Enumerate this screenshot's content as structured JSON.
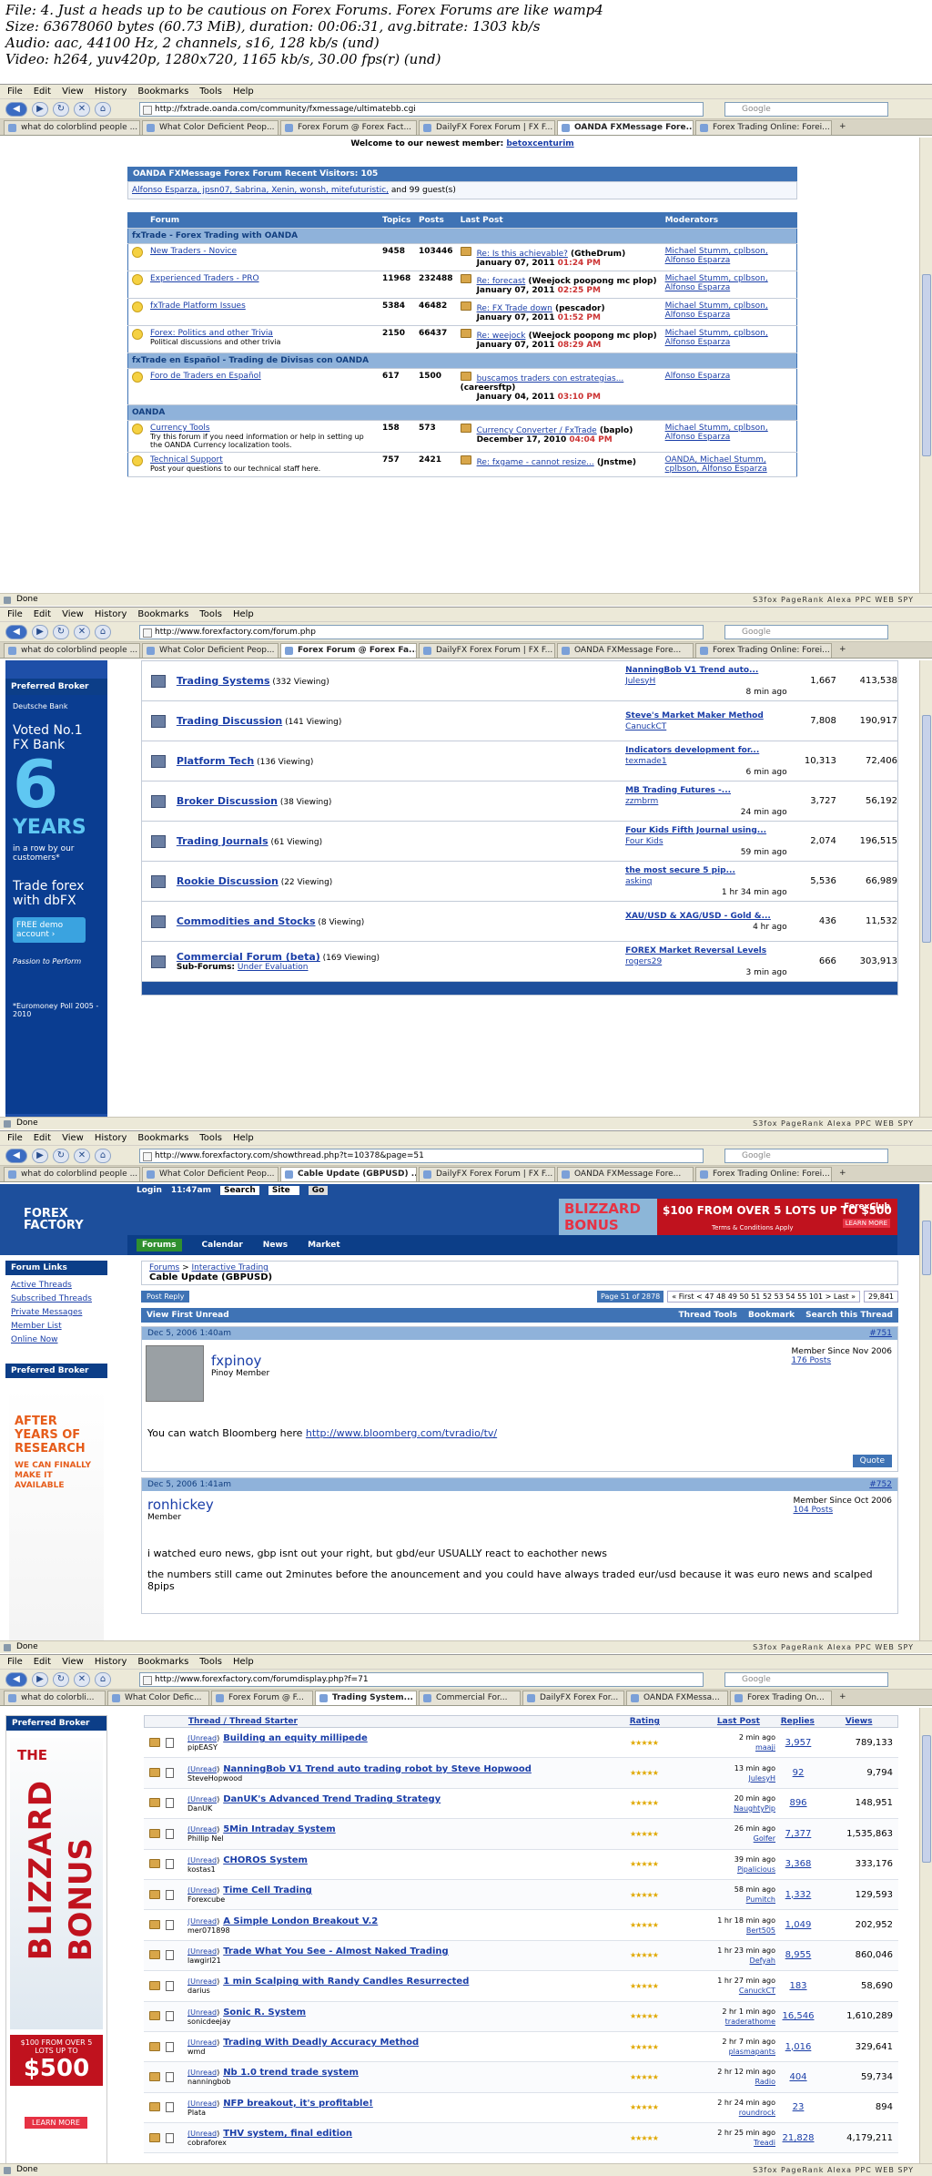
{
  "header": {
    "line1": "File: 4. Just a heads up to be cautious on Forex Forums.          Forex Forums are like wamp4",
    "line2": "Size: 63678060 bytes (60.73 MiB), duration: 00:06:31, avg.bitrate: 1303 kb/s",
    "line3": "Audio: aac, 44100 Hz, 2 channels, s16, 128 kb/s (und)",
    "line4": "Video: h264, yuv420p, 1280x720, 1165 kb/s, 30.00 fps(r) (und)"
  },
  "menu": [
    "File",
    "Edit",
    "View",
    "History",
    "Bookmarks",
    "Tools",
    "Help"
  ],
  "search_placeholder": "Google",
  "status_done": "Done",
  "status_tools": "S3fox  PageRank  Alexa  PPC WEB SPY",
  "win1": {
    "url": "http://fxtrade.oanda.com/community/fxmessage/ultimatebb.cgi",
    "tabs": [
      "what do colorblind people ...",
      "What Color Deficient Peop...",
      "Forex Forum @ Forex Fact...",
      "DailyFX Forex Forum | FX F...",
      "OANDA FXMessage Fore...",
      "Forex Trading Online: Forei..."
    ],
    "active_tab": 4,
    "newest_member": "Welcome to our newest member: ",
    "newest_name": "betoxcenturim",
    "visitors_title": "OANDA FXMessage Forex Forum Recent Visitors: 105",
    "visitors_list": "Alfonso Esparza, jpsn07, Sabrina, Xenin, wonsh, mitefuturistic,",
    "visitors_tail": " and 99 guest(s)",
    "cols": [
      "Forum",
      "Topics",
      "Posts",
      "Last Post",
      "Moderators"
    ],
    "section1": "fxTrade - Forex Trading with OANDA",
    "section2": "fxTrade en Español - Trading de Divisas con OANDA",
    "section3": "OANDA",
    "rows": [
      {
        "name": "New Traders - Novice",
        "desc": "",
        "topics": "9458",
        "posts": "103446",
        "lp_title": "Re: Is this achievable?",
        "lp_by": " (GtheDrum)",
        "lp_date": "January 07, 2011 ",
        "lp_time": "01:24 PM",
        "mods": "Michael Stumm, cplbson,",
        "mods2": "Alfonso Esparza"
      },
      {
        "name": "Experienced Traders - PRO",
        "desc": "",
        "topics": "11968",
        "posts": "232488",
        "lp_title": "Re: forecast",
        "lp_by": " (Weejock poopong mc plop)",
        "lp_date": "January 07, 2011 ",
        "lp_time": "02:25 PM",
        "mods": "Michael Stumm, cplbson,",
        "mods2": "Alfonso Esparza"
      },
      {
        "name": "fxTrade Platform Issues",
        "desc": "",
        "topics": "5384",
        "posts": "46482",
        "lp_title": "Re: FX Trade down",
        "lp_by": " (pescador)",
        "lp_date": "January 07, 2011 ",
        "lp_time": "01:52 PM",
        "mods": "Michael Stumm, cplbson,",
        "mods2": "Alfonso Esparza"
      },
      {
        "name": "Forex: Politics and other Trivia",
        "desc": "Political discussions and other trivia",
        "topics": "2150",
        "posts": "66437",
        "lp_title": "Re: weejock",
        "lp_by": " (Weejock poopong mc plop)",
        "lp_date": "January 07, 2011 ",
        "lp_time": "08:29 AM",
        "mods": "Michael Stumm, cplbson,",
        "mods2": "Alfonso Esparza"
      }
    ],
    "rows_es": [
      {
        "name": "Foro de Traders en Español",
        "desc": "",
        "topics": "617",
        "posts": "1500",
        "lp_title": "buscamos traders con estrategias...",
        "lp_by": " (careersftp)",
        "lp_date": "January 04, 2011 ",
        "lp_time": "03:10 PM",
        "mods": "Alfonso Esparza",
        "mods2": ""
      }
    ],
    "rows_oanda": [
      {
        "name": "Currency Tools",
        "desc": "Try this forum if you need information or help in setting up the OANDA Currency localization tools.",
        "topics": "158",
        "posts": "573",
        "lp_title": "Currency Converter / FxTrade",
        "lp_by": " (baplo)",
        "lp_date": "December 17, 2010 ",
        "lp_time": "04:04 PM",
        "mods": "Michael Stumm, cplbson,",
        "mods2": "Alfonso Esparza"
      },
      {
        "name": "Technical Support",
        "desc": "Post your questions to our technical staff here.",
        "topics": "757",
        "posts": "2421",
        "lp_title": "Re: fxgame - cannot resize...",
        "lp_by": " (Jnstme)",
        "lp_date": "",
        "lp_time": "",
        "mods": "OANDA, Michael Stumm,",
        "mods2": "cplbson, Alfonso Esparza"
      }
    ]
  },
  "win2": {
    "url": "http://www.forexfactory.com/forum.php",
    "tabs": [
      "what do colorblind people ...",
      "What Color Deficient Peop...",
      "Forex Forum @ Forex Fa...",
      "DailyFX Forex Forum | FX F...",
      "OANDA FXMessage Fore...",
      "Forex Trading Online: Forei..."
    ],
    "active_tab": 2,
    "broker_title": "Preferred Broker",
    "ad_bank": "Deutsche Bank",
    "ad_voted": "Voted No.1 FX Bank",
    "ad_num": "6",
    "ad_years": "YEARS",
    "ad_row": "in a row by our customers*",
    "ad_trade": "Trade forex with dbFX",
    "ad_demo": "FREE demo account ›",
    "ad_passion": "Passion to Perform",
    "ad_poll": "*Euromoney Poll 2005 - 2010",
    "forums": [
      {
        "name": "Trading Systems",
        "viewing": " (332 Viewing)",
        "lp": "NanningBob V1 Trend auto...",
        "by": "JulesyH",
        "ago": "8 min ago",
        "threads": "1,667",
        "posts": "413,538"
      },
      {
        "name": "Trading Discussion",
        "viewing": " (141 Viewing)",
        "lp": "Steve's Market Maker Method",
        "by": "CanuckCT",
        "ago": "",
        "threads": "7,808",
        "posts": "190,917"
      },
      {
        "name": "Platform Tech",
        "viewing": " (136 Viewing)",
        "lp": "Indicators development for...",
        "by": "texmade1",
        "ago": "6 min ago",
        "threads": "10,313",
        "posts": "72,406"
      },
      {
        "name": "Broker Discussion",
        "viewing": " (38 Viewing)",
        "lp": "MB Trading Futures -...",
        "by": "zzmbrm",
        "ago": "24 min ago",
        "threads": "3,727",
        "posts": "56,192"
      },
      {
        "name": "Trading Journals",
        "viewing": " (61 Viewing)",
        "lp": "Four Kids Fifth Journal using...",
        "by": "Four Kids",
        "ago": "59 min ago",
        "threads": "2,074",
        "posts": "196,515"
      },
      {
        "name": "Rookie Discussion",
        "viewing": " (22 Viewing)",
        "lp": "the most secure 5 pip...",
        "by": "askinq",
        "ago": "1 hr 34 min ago",
        "threads": "5,536",
        "posts": "66,989"
      },
      {
        "name": "Commodities and Stocks",
        "viewing": " (8 Viewing)",
        "lp": "XAU/USD & XAG/USD - Gold &...",
        "by": "",
        "ago": "4 hr ago",
        "threads": "436",
        "posts": "11,532"
      },
      {
        "name": "Commercial Forum (beta)",
        "viewing": " (169 Viewing)",
        "lp": "FOREX Market Reversal Levels",
        "by": "rogers29",
        "ago": "3 min ago",
        "threads": "666",
        "posts": "303,913",
        "sub_label": "Sub-Forums:",
        "sub_link": "Under Evaluation"
      }
    ]
  },
  "win3": {
    "url": "http://www.forexfactory.com/showthread.php?t=10378&page=51",
    "tabs": [
      "what do colorblind people ...",
      "What Color Deficient Peop...",
      "Cable Update (GBPUSD) ...",
      "DailyFX Forex Forum | FX F...",
      "OANDA FXMessage Fore...",
      "Forex Trading Online: Forei..."
    ],
    "active_tab": 2,
    "topbar": [
      "Login",
      "11:47am",
      "Search",
      "Site",
      "Go"
    ],
    "logo": "FOREX FACTORY",
    "ad_title": "BLIZZARD BONUS",
    "ad_offer": "$100 FROM OVER 5 LOTS UP TO $500",
    "ad_terms": "Terms & Conditions Apply",
    "ad_brand": "ForexClub",
    "ad_learn": "LEARN MORE",
    "nav": [
      "Forums",
      "Calendar",
      "News",
      "Market"
    ],
    "links_title": "Forum Links",
    "links": [
      "Active Threads",
      "Subscribed Threads",
      "Private Messages",
      "Member List",
      "Online Now"
    ],
    "broker_title": "Preferred Broker",
    "sideline1": "AFTER YEARS OF RESEARCH",
    "sideline2": "WE CAN FINALLY MAKE IT AVAILABLE",
    "bc1": "Forums",
    "bc2": "Interactive Trading",
    "thread_title": "Cable Update (GBPUSD)",
    "post_reply": "Post Reply",
    "pagination": "Page 51 of 2878",
    "pages": "« First  <  47  48  49  50  51  52  53  54  55  101  >  Last »",
    "page_count": "29,841",
    "view_first": "View First Unread",
    "thread_tools": "Thread Tools",
    "bookmark": "Bookmark",
    "search_thread": "Search this Thread",
    "post1": {
      "date": "Dec 5, 2006 1:40am",
      "num": "#751",
      "user": "fxpinoy",
      "role": "Pinoy Member",
      "since": "Member Since Nov 2006",
      "posts": "176 Posts",
      "text": "You can watch Bloomberg here ",
      "link": "http://www.bloomberg.com/tvradio/tv/",
      "quote": "Quote"
    },
    "post2": {
      "date": "Dec 5, 2006 1:41am",
      "num": "#752",
      "user": "ronhickey",
      "role": "Member",
      "since": "Member Since Oct 2006",
      "posts": "104 Posts",
      "text1": "i watched euro news, gbp isnt out your right, but gbd/eur USUALLY react to eachother news",
      "text2": "the numbers still came out 2minutes before the anouncement and you could have always traded eur/usd because it was euro news and scalped 8pips"
    }
  },
  "win4": {
    "url": "http://www.forexfactory.com/forumdisplay.php?f=71",
    "tabs": [
      "what do colorbli...",
      "What Color Defic...",
      "Forex Forum @ F...",
      "Trading System...",
      "Commercial For...",
      "DailyFX Forex For...",
      "OANDA FXMessa...",
      "Forex Trading On..."
    ],
    "active_tab": 3,
    "broker_title": "Preferred Broker",
    "ad_the": "THE",
    "ad_blizzard": "BLIZZARD",
    "ad_bonus": "BONUS",
    "ad_offer": "$100 FROM OVER 5 LOTS UP TO",
    "ad_amount": "$500",
    "ad_learn": "LEARN MORE",
    "cols": [
      "Thread",
      "Thread Starter",
      "Rating",
      "Last Post",
      "Replies",
      "Views"
    ],
    "threads": [
      {
        "title": "Building an equity millipede",
        "starter": "pipEASY",
        "last": "2 min ago",
        "by": "maaji",
        "replies": "3,957",
        "views": "789,133"
      },
      {
        "title": "NanningBob V1 Trend auto trading robot by Steve Hopwood",
        "starter": "SteveHopwood",
        "last": "13 min ago",
        "by": "JulesyH",
        "replies": "92",
        "views": "9,794"
      },
      {
        "title": "DanUK's Advanced Trend Trading Strategy",
        "starter": "DanUK",
        "last": "20 min ago",
        "by": "NaughtyPip",
        "replies": "896",
        "views": "148,951"
      },
      {
        "title": "5Min Intraday System",
        "starter": "Phillip Nel",
        "last": "26 min ago",
        "by": "Golfer",
        "replies": "7,377",
        "views": "1,535,863"
      },
      {
        "title": "CHOROS System",
        "starter": "kostas1",
        "last": "39 min ago",
        "by": "Pipalicious",
        "replies": "3,368",
        "views": "333,176"
      },
      {
        "title": "Time Cell Trading",
        "starter": "Forexcube",
        "last": "58 min ago",
        "by": "Pumitch",
        "replies": "1,332",
        "views": "129,593"
      },
      {
        "title": "A Simple London Breakout V.2",
        "starter": "mer071898",
        "last": "1 hr 18 min ago",
        "by": "Bert505",
        "replies": "1,049",
        "views": "202,952"
      },
      {
        "title": "Trade What You See - Almost Naked Trading",
        "starter": "lawgirl21",
        "last": "1 hr 23 min ago",
        "by": "Defyah",
        "replies": "8,955",
        "views": "860,046"
      },
      {
        "title": "1 min Scalping with Randy Candles Resurrected",
        "starter": "darius",
        "last": "1 hr 27 min ago",
        "by": "CanuckCT",
        "replies": "183",
        "views": "58,690"
      },
      {
        "title": "Sonic R. System",
        "starter": "sonicdeejay",
        "last": "2 hr 1 min ago",
        "by": "traderathome",
        "replies": "16,546",
        "views": "1,610,289"
      },
      {
        "title": "Trading With Deadly Accuracy Method",
        "starter": "wmd",
        "last": "2 hr 7 min ago",
        "by": "plasmapants",
        "replies": "1,016",
        "views": "329,641"
      },
      {
        "title": "Nb 1.0 trend trade system",
        "starter": "nanningbob",
        "last": "2 hr 12 min ago",
        "by": "Radio",
        "replies": "404",
        "views": "59,734"
      },
      {
        "title": "NFP breakout, it's profitable!",
        "starter": "Plata",
        "last": "2 hr 24 min ago",
        "by": "roundrock",
        "replies": "23",
        "views": "894"
      },
      {
        "title": "THV system, final edition",
        "starter": "cobraforex",
        "last": "2 hr 25 min ago",
        "by": "Treadi",
        "replies": "21,828",
        "views": "4,179,211"
      }
    ],
    "unread": "(Unread",
    "unread_close": ")"
  }
}
